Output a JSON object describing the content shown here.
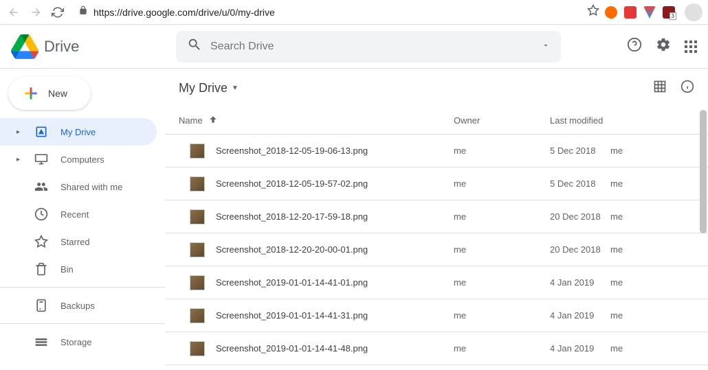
{
  "browser": {
    "url": "https://drive.google.com/drive/u/0/my-drive"
  },
  "header": {
    "app_name": "Drive",
    "search_placeholder": "Search Drive"
  },
  "sidebar": {
    "new_label": "New",
    "items": [
      {
        "label": "My Drive",
        "has_caret": true,
        "active": true
      },
      {
        "label": "Computers",
        "has_caret": true,
        "active": false
      },
      {
        "label": "Shared with me",
        "has_caret": false,
        "active": false
      },
      {
        "label": "Recent",
        "has_caret": false,
        "active": false
      },
      {
        "label": "Starred",
        "has_caret": false,
        "active": false
      },
      {
        "label": "Bin",
        "has_caret": false,
        "active": false
      }
    ],
    "backups_label": "Backups",
    "storage_label": "Storage"
  },
  "breadcrumb": {
    "label": "My Drive"
  },
  "columns": {
    "name": "Name",
    "owner": "Owner",
    "modified": "Last modified"
  },
  "files": [
    {
      "name": "Screenshot_2018-12-05-19-06-13.png",
      "owner": "me",
      "date": "5 Dec 2018",
      "by": "me"
    },
    {
      "name": "Screenshot_2018-12-05-19-57-02.png",
      "owner": "me",
      "date": "5 Dec 2018",
      "by": "me"
    },
    {
      "name": "Screenshot_2018-12-20-17-59-18.png",
      "owner": "me",
      "date": "20 Dec 2018",
      "by": "me"
    },
    {
      "name": "Screenshot_2018-12-20-20-00-01.png",
      "owner": "me",
      "date": "20 Dec 2018",
      "by": "me"
    },
    {
      "name": "Screenshot_2019-01-01-14-41-01.png",
      "owner": "me",
      "date": "4 Jan 2019",
      "by": "me"
    },
    {
      "name": "Screenshot_2019-01-01-14-41-31.png",
      "owner": "me",
      "date": "4 Jan 2019",
      "by": "me"
    },
    {
      "name": "Screenshot_2019-01-01-14-41-48.png",
      "owner": "me",
      "date": "4 Jan 2019",
      "by": "me"
    }
  ]
}
